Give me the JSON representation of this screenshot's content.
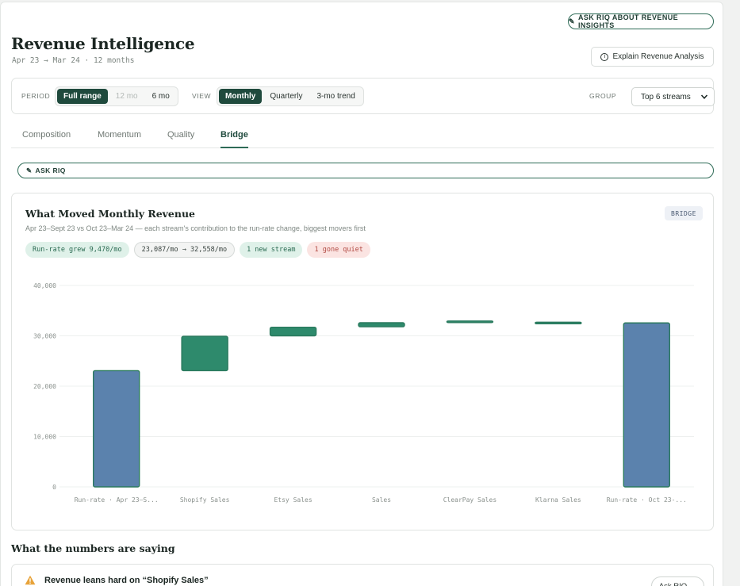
{
  "header": {
    "ask_insights_label": "ASK RIQ ABOUT REVENUE INSIGHTS",
    "title": "Revenue Intelligence",
    "subtitle": "Apr 23 → Mar 24 · 12 months",
    "explain_button": "Explain Revenue Analysis"
  },
  "filters": {
    "period_label": "PERIOD",
    "period_options": [
      "Full range",
      "12 mo",
      "6 mo"
    ],
    "period_selected": "Full range",
    "view_label": "VIEW",
    "view_options": [
      "Monthly",
      "Quarterly",
      "3-mo trend"
    ],
    "view_selected": "Monthly",
    "group_label": "GROUP",
    "group_selected": "Top 6 streams"
  },
  "tabs": [
    "Composition",
    "Momentum",
    "Quality",
    "Bridge"
  ],
  "active_tab": "Bridge",
  "ask_bar_label": "ASK RIQ",
  "card": {
    "title": "What Moved Monthly Revenue",
    "subtitle": "Apr 23–Sept 23 vs Oct 23–Mar 24 — each stream's contribution to the run-rate change, biggest movers first",
    "badge": "BRIDGE",
    "pills": [
      {
        "text": "Run-rate grew 9,470/mo",
        "tone": "green"
      },
      {
        "text": "23,087/mo → 32,558/mo",
        "tone": "grey"
      },
      {
        "text": "1 new stream",
        "tone": "green"
      },
      {
        "text": "1 gone quiet",
        "tone": "red"
      }
    ]
  },
  "colors": {
    "total": "#5b82ad",
    "increase": "#2e8a6c",
    "border": "#2b7a5e",
    "grid": "#eef0ef",
    "tick": "#8a918d"
  },
  "chart_data": {
    "type": "bar",
    "subtype": "waterfall",
    "categories": [
      "Run-rate · Apr 23–S...",
      "Shopify Sales",
      "Etsy Sales",
      "Sales",
      "ClearPay Sales",
      "Klarna Sales",
      "Run-rate · Oct 23-..."
    ],
    "bars": [
      {
        "kind": "total",
        "start": 0,
        "end": 23087
      },
      {
        "kind": "delta",
        "start": 23087,
        "end": 29900
      },
      {
        "kind": "delta",
        "start": 30000,
        "end": 31700
      },
      {
        "kind": "delta",
        "start": 31800,
        "end": 32600
      },
      {
        "kind": "delta",
        "start": 32700,
        "end": 32950
      },
      {
        "kind": "delta",
        "start": 32450,
        "end": 32700
      },
      {
        "kind": "total",
        "start": 0,
        "end": 32558
      }
    ],
    "yticks": [
      0,
      10000,
      20000,
      30000,
      40000
    ],
    "ytick_labels": [
      "0",
      "10,000",
      "20,000",
      "30,000",
      "40,000"
    ],
    "ylim": [
      0,
      40000
    ],
    "grid": true
  },
  "section_title": "What the numbers are saying",
  "insight": {
    "title": "Revenue leans hard on “Shopify Sales”",
    "ask_label": "Ask RIQ →"
  }
}
